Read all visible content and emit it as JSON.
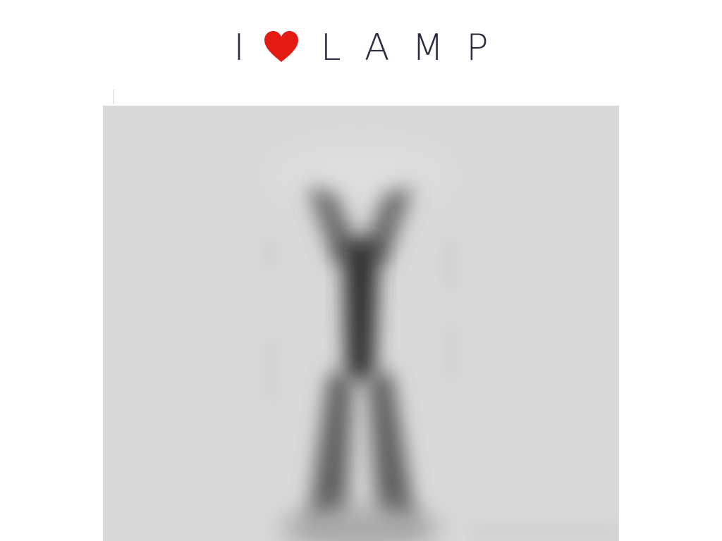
{
  "header": {
    "logo": {
      "letter": "I",
      "icon": "heart-icon",
      "word": "LAMP",
      "heart_color": "#e31b13",
      "text_color": "#2b2c3f"
    }
  },
  "main": {
    "product_image": {
      "icon": "floor-lamp-image",
      "background": "#d9d9d9"
    }
  }
}
